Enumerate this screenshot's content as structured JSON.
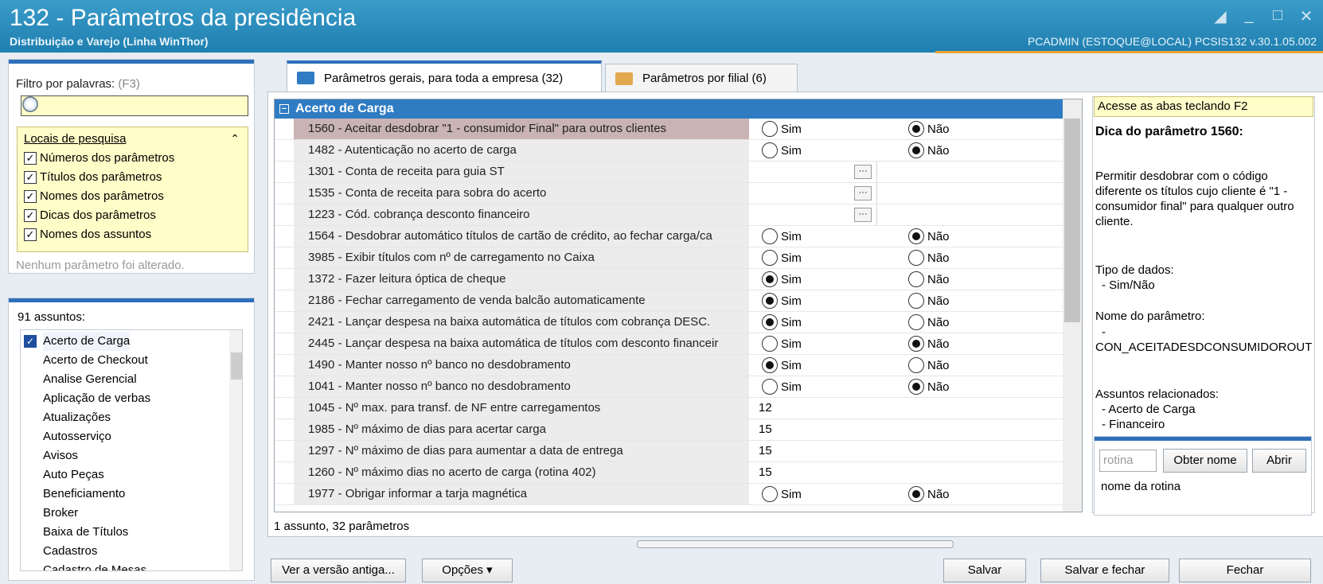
{
  "window": {
    "title": "132 - Parâmetros da presidência",
    "subtitle": "Distribuição e Varejo (Linha WinThor)",
    "user_info": "PCADMIN (ESTOQUE@LOCAL)   PCSIS132  v.30.1.05.002"
  },
  "filter": {
    "label": "Filtro por palavras:",
    "shortcut": "(F3)",
    "value": ""
  },
  "locais": {
    "title": "Locais de pesquisa",
    "items": [
      "Números dos parâmetros",
      "Títulos dos parâmetros",
      "Nomes dos parâmetros",
      "Dicas dos parâmetros",
      "Nomes dos assuntos"
    ]
  },
  "status_text": "Nenhum parâmetro foi alterado.",
  "subjects": {
    "count_label": "91 assuntos:",
    "items": [
      "Acerto de Carga",
      "Acerto de Checkout",
      "Analise Gerencial",
      "Aplicação de verbas",
      "Atualizações",
      "Autosserviço",
      "Avisos",
      "Auto Peças",
      "Beneficiamento",
      "Broker",
      "Baixa de Títulos",
      "Cadastros",
      "Cadastro de Mesas"
    ]
  },
  "tabs": [
    {
      "label": "Parâmetros gerais, para toda a empresa  (32)"
    },
    {
      "label": "Parâmetros por filial  (6)"
    }
  ],
  "grid": {
    "group": "Acerto de Carga",
    "sim": "Sim",
    "nao": "Não",
    "rows": [
      {
        "label": "1560 - Aceitar desdobrar \"1 - consumidor Final\" para outros clientes",
        "type": "radio",
        "value": "Não"
      },
      {
        "label": "1482 - Autenticação no acerto de carga",
        "type": "radio",
        "value": "Não"
      },
      {
        "label": "1301 - Conta de receita para guia ST",
        "type": "lookup",
        "value": ""
      },
      {
        "label": "1535 - Conta de receita para sobra do acerto",
        "type": "lookup",
        "value": ""
      },
      {
        "label": "1223 - Cód. cobrança desconto financeiro",
        "type": "lookup",
        "value": ""
      },
      {
        "label": "1564 - Desdobrar automático títulos de cartão de crédito, ao fechar carga/ca",
        "type": "radio",
        "value": "Não"
      },
      {
        "label": "3985 - Exibir títulos com nº de carregamento no Caixa",
        "type": "radio",
        "value": "none"
      },
      {
        "label": "1372 - Fazer leitura óptica de cheque",
        "type": "radio",
        "value": "Sim"
      },
      {
        "label": "2186 - Fechar carregamento de venda balcão automaticamente",
        "type": "radio",
        "value": "Sim"
      },
      {
        "label": "2421 - Lançar despesa na baixa automática de títulos com cobrança DESC.",
        "type": "radio",
        "value": "Sim"
      },
      {
        "label": "2445 - Lançar despesa na baixa automática de títulos com desconto financeir",
        "type": "radio",
        "value": "Não"
      },
      {
        "label": "1490 - Manter nosso nº banco no desdobramento",
        "type": "radio",
        "value": "Sim"
      },
      {
        "label": "1041 - Manter nosso nº banco no desdobramento",
        "type": "radio",
        "value": "Não"
      },
      {
        "label": "1045 - Nº max. para transf. de NF entre carregamentos",
        "type": "number",
        "value": "12"
      },
      {
        "label": "1985 - Nº máximo de dias para acertar carga",
        "type": "number",
        "value": "15"
      },
      {
        "label": "1297 - Nº máximo de dias para aumentar a data de entrega",
        "type": "number",
        "value": "15"
      },
      {
        "label": "1260 - Nº máximo dias no acerto de carga (rotina 402)",
        "type": "number",
        "value": "15"
      },
      {
        "label": "1977 - Obrigar informar a tarja magnética",
        "type": "radio",
        "value": "Não"
      }
    ]
  },
  "footer_count": "1 assunto, 32 parâmetros",
  "tip": {
    "hint": "Acesse as abas teclando F2",
    "title": "Dica do parâmetro 1560:",
    "description": "Permitir desdobrar com o código diferente os títulos cujo cliente é \"1 - consumidor final\" para qualquer outro cliente.",
    "data_type_label": "Tipo de dados:",
    "data_type_value": "- Sim/Não",
    "name_label": "Nome do parâmetro:",
    "name_dash": "-",
    "name_value": "CON_ACEITADESDCONSUMIDOROUT",
    "related_label": "Assuntos relacionados:",
    "related": [
      "- Acerto de Carga",
      "- Financeiro"
    ]
  },
  "rotina": {
    "placeholder": "rotina",
    "get_name": "Obter nome",
    "open": "Abrir",
    "name_text": "nome da rotina"
  },
  "buttons": {
    "old_version": "Ver a versão antiga...",
    "options": "Opções",
    "save": "Salvar",
    "save_close": "Salvar e fechar",
    "close": "Fechar"
  },
  "colors": {
    "title_bar": "#2a8cbe",
    "accent": "#2f7cc3",
    "highlight": "#fffdc8"
  }
}
